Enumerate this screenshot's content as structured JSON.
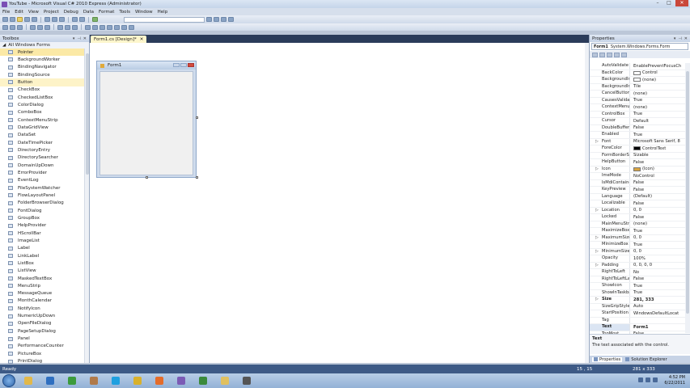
{
  "window": {
    "title": "YouTube - Microsoft Visual C# 2010 Express (Administrator)"
  },
  "menu": [
    "File",
    "Edit",
    "View",
    "Project",
    "Debug",
    "Data",
    "Format",
    "Tools",
    "Window",
    "Help"
  ],
  "toolbox": {
    "title": "Toolbox",
    "group": "All Windows Forms",
    "items": [
      {
        "label": "Pointer",
        "icon": "pointer-icon"
      },
      {
        "label": "BackgroundWorker",
        "icon": "backgroundworker-icon"
      },
      {
        "label": "BindingNavigator",
        "icon": "bindingnavigator-icon"
      },
      {
        "label": "BindingSource",
        "icon": "bindingsource-icon"
      },
      {
        "label": "Button",
        "icon": "button-icon"
      },
      {
        "label": "CheckBox",
        "icon": "checkbox-icon"
      },
      {
        "label": "CheckedListBox",
        "icon": "checkedlistbox-icon"
      },
      {
        "label": "ColorDialog",
        "icon": "colordialog-icon"
      },
      {
        "label": "ComboBox",
        "icon": "combobox-icon"
      },
      {
        "label": "ContextMenuStrip",
        "icon": "contextmenustrip-icon"
      },
      {
        "label": "DataGridView",
        "icon": "datagridview-icon"
      },
      {
        "label": "DataSet",
        "icon": "dataset-icon"
      },
      {
        "label": "DateTimePicker",
        "icon": "datetimepicker-icon"
      },
      {
        "label": "DirectoryEntry",
        "icon": "directoryentry-icon"
      },
      {
        "label": "DirectorySearcher",
        "icon": "directorysearcher-icon"
      },
      {
        "label": "DomainUpDown",
        "icon": "domainupdown-icon"
      },
      {
        "label": "ErrorProvider",
        "icon": "errorprovider-icon"
      },
      {
        "label": "EventLog",
        "icon": "eventlog-icon"
      },
      {
        "label": "FileSystemWatcher",
        "icon": "filesystemwatcher-icon"
      },
      {
        "label": "FlowLayoutPanel",
        "icon": "flowlayoutpanel-icon"
      },
      {
        "label": "FolderBrowserDialog",
        "icon": "folderbrowserdialog-icon"
      },
      {
        "label": "FontDialog",
        "icon": "fontdialog-icon"
      },
      {
        "label": "GroupBox",
        "icon": "groupbox-icon"
      },
      {
        "label": "HelpProvider",
        "icon": "helpprovider-icon"
      },
      {
        "label": "HScrollBar",
        "icon": "hscrollbar-icon"
      },
      {
        "label": "ImageList",
        "icon": "imagelist-icon"
      },
      {
        "label": "Label",
        "icon": "label-icon"
      },
      {
        "label": "LinkLabel",
        "icon": "linklabel-icon"
      },
      {
        "label": "ListBox",
        "icon": "listbox-icon"
      },
      {
        "label": "ListView",
        "icon": "listview-icon"
      },
      {
        "label": "MaskedTextBox",
        "icon": "maskedtextbox-icon"
      },
      {
        "label": "MenuStrip",
        "icon": "menustrip-icon"
      },
      {
        "label": "MessageQueue",
        "icon": "messagequeue-icon"
      },
      {
        "label": "MonthCalendar",
        "icon": "monthcalendar-icon"
      },
      {
        "label": "NotifyIcon",
        "icon": "notifyicon-icon"
      },
      {
        "label": "NumericUpDown",
        "icon": "numericupdown-icon"
      },
      {
        "label": "OpenFileDialog",
        "icon": "openfiledialog-icon"
      },
      {
        "label": "PageSetupDialog",
        "icon": "pagesetupdialog-icon"
      },
      {
        "label": "Panel",
        "icon": "panel-icon"
      },
      {
        "label": "PerformanceCounter",
        "icon": "performancecounter-icon"
      },
      {
        "label": "PictureBox",
        "icon": "picturebox-icon"
      },
      {
        "label": "PrintDialog",
        "icon": "printdialog-icon"
      }
    ]
  },
  "editor": {
    "tab_label": "Form1.cs [Design]*",
    "form_title": "Form1"
  },
  "properties": {
    "title": "Properties",
    "object_name": "Form1",
    "object_type": "System.Windows.Forms.Form",
    "rows": [
      {
        "name": "AutoValidate",
        "value": "EnablePreventFocusCh"
      },
      {
        "name": "BackColor",
        "value": "Control",
        "swatch": "#ffffff"
      },
      {
        "name": "BackgroundImage",
        "value": "(none)",
        "swatch": "#ffffff"
      },
      {
        "name": "BackgroundImageLayout",
        "value": "Tile"
      },
      {
        "name": "CancelButton",
        "value": "(none)"
      },
      {
        "name": "CausesValidation",
        "value": "True"
      },
      {
        "name": "ContextMenuStrip",
        "value": "(none)"
      },
      {
        "name": "ControlBox",
        "value": "True"
      },
      {
        "name": "Cursor",
        "value": "Default"
      },
      {
        "name": "DoubleBuffered",
        "value": "False"
      },
      {
        "name": "Enabled",
        "value": "True"
      },
      {
        "name": "Font",
        "value": "Microsoft Sans Serif, 8",
        "expand": true
      },
      {
        "name": "ForeColor",
        "value": "ControlText",
        "swatch": "#000000"
      },
      {
        "name": "FormBorderStyle",
        "value": "Sizable"
      },
      {
        "name": "HelpButton",
        "value": "False"
      },
      {
        "name": "Icon",
        "value": "(Icon)",
        "expand": true,
        "swatch": "#d9a441"
      },
      {
        "name": "ImeMode",
        "value": "NoControl"
      },
      {
        "name": "IsMdiContainer",
        "value": "False"
      },
      {
        "name": "KeyPreview",
        "value": "False"
      },
      {
        "name": "Language",
        "value": "(Default)"
      },
      {
        "name": "Localizable",
        "value": "False"
      },
      {
        "name": "Location",
        "value": "0, 0",
        "expand": true
      },
      {
        "name": "Locked",
        "value": "False"
      },
      {
        "name": "MainMenuStrip",
        "value": "(none)"
      },
      {
        "name": "MaximizeBox",
        "value": "True"
      },
      {
        "name": "MaximumSize",
        "value": "0, 0",
        "expand": true
      },
      {
        "name": "MinimizeBox",
        "value": "True"
      },
      {
        "name": "MinimumSize",
        "value": "0, 0",
        "expand": true
      },
      {
        "name": "Opacity",
        "value": "100%"
      },
      {
        "name": "Padding",
        "value": "0, 0, 0, 0",
        "expand": true
      },
      {
        "name": "RightToLeft",
        "value": "No"
      },
      {
        "name": "RightToLeftLayout",
        "value": "False"
      },
      {
        "name": "ShowIcon",
        "value": "True"
      },
      {
        "name": "ShowInTaskbar",
        "value": "True"
      },
      {
        "name": "Size",
        "value": "281, 333",
        "expand": true,
        "bold": true
      },
      {
        "name": "SizeGripStyle",
        "value": "Auto"
      },
      {
        "name": "StartPosition",
        "value": "WindowsDefaultLocat"
      },
      {
        "name": "Tag",
        "value": ""
      },
      {
        "name": "Text",
        "value": "Form1",
        "bold": true,
        "selected": true
      },
      {
        "name": "TopMost",
        "value": "False"
      }
    ],
    "description_title": "Text",
    "description_text": "The text associated with the control.",
    "tabs": [
      "Properties",
      "Solution Explorer"
    ]
  },
  "status": {
    "text": "Ready",
    "position": "15 , 15",
    "size": "281 x 333"
  },
  "clock": {
    "time": "4:52 PM",
    "date": "6/22/2011"
  },
  "taskbar_apps": [
    {
      "name": "explorer-app",
      "color": "#e2b84a"
    },
    {
      "name": "media-player-app",
      "color": "#2f6fc0"
    },
    {
      "name": "chrome-app",
      "color": "#3c9b3c"
    },
    {
      "name": "gimp-app",
      "color": "#b07a4a"
    },
    {
      "name": "skype-app",
      "color": "#1fa0e0"
    },
    {
      "name": "camtasia-app",
      "color": "#d9b12c"
    },
    {
      "name": "office-app",
      "color": "#e46c2a"
    },
    {
      "name": "visual-studio-app",
      "color": "#7b5bb5"
    },
    {
      "name": "excel-app",
      "color": "#3b8a3b"
    },
    {
      "name": "folder-app",
      "color": "#e0c060"
    },
    {
      "name": "app-generic",
      "color": "#555555"
    }
  ]
}
